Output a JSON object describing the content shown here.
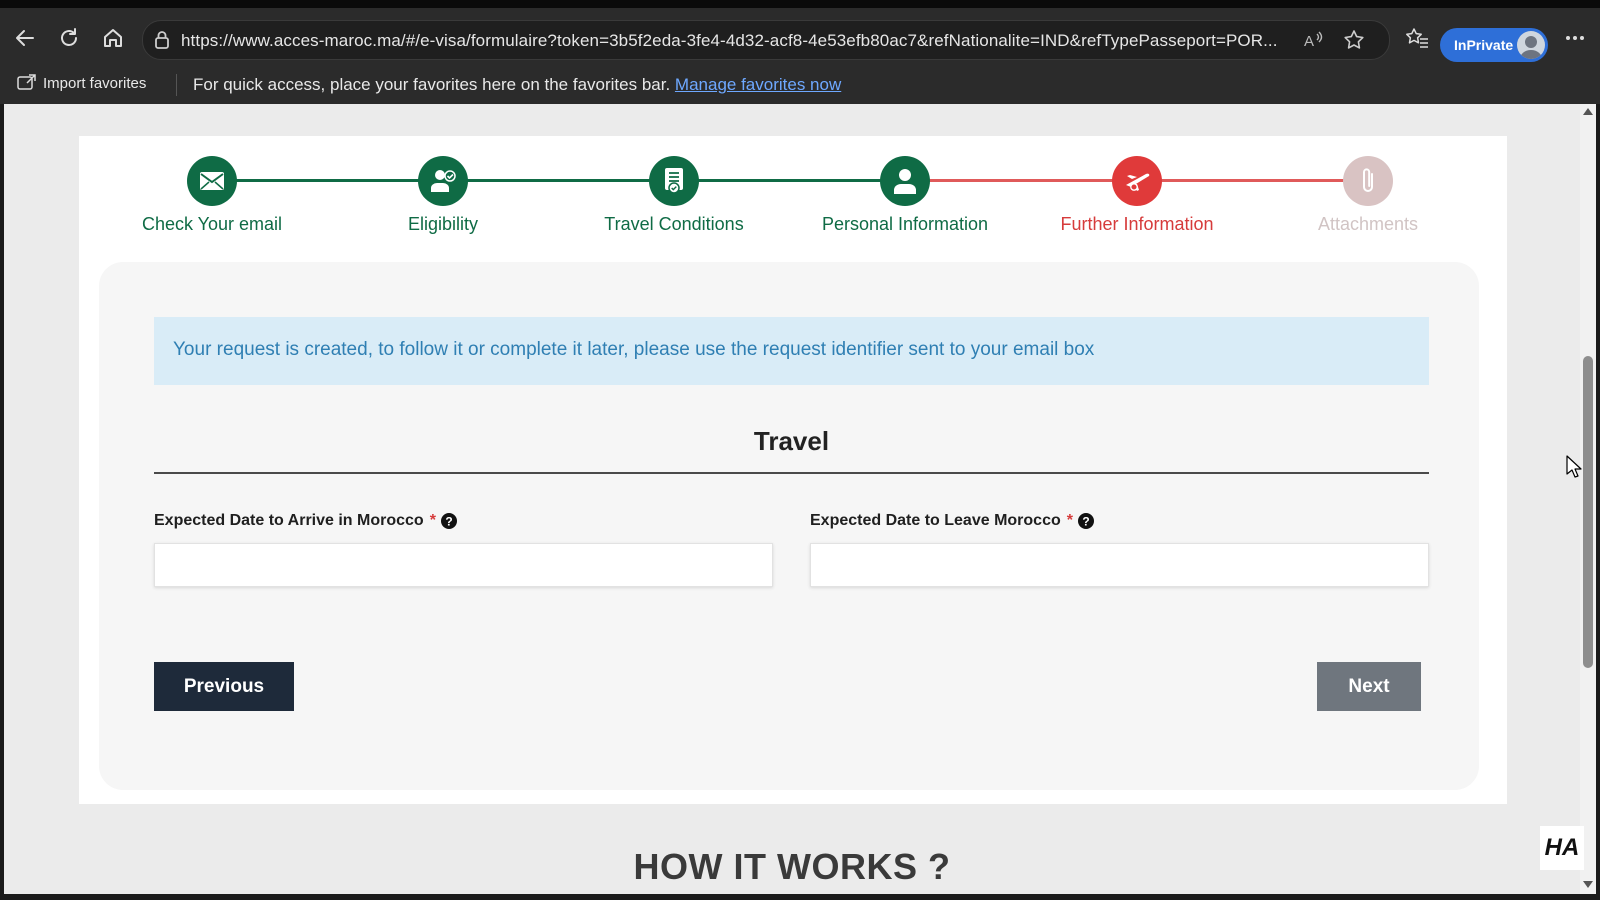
{
  "browser": {
    "url": "https://www.acces-maroc.ma/#/e-visa/formulaire?token=3b5f2eda-3fe4-4d32-acf8-4e53efb80ac7&refNationalite=IND&refTypePasseport=POR...",
    "inprivate_label": "InPrivate",
    "favorites": {
      "import_label": "Import favorites",
      "message": "For quick access, place your favorites here on the favorites bar.",
      "manage_link": "Manage favorites now"
    }
  },
  "stepper": {
    "steps": [
      {
        "label": "Check Your email",
        "icon": "envelope-icon",
        "state": "done"
      },
      {
        "label": "Eligibility",
        "icon": "person-check-icon",
        "state": "done"
      },
      {
        "label": "Travel Conditions",
        "icon": "document-badge-icon",
        "state": "done"
      },
      {
        "label": "Personal Information",
        "icon": "person-icon",
        "state": "done"
      },
      {
        "label": "Further Information",
        "icon": "plane-icon",
        "state": "active"
      },
      {
        "label": "Attachments",
        "icon": "paperclip-icon",
        "state": "pending"
      }
    ],
    "colors": {
      "done": "#0f6b45",
      "active": "#e03a3a",
      "pending": "#d9c3c3"
    }
  },
  "form": {
    "alert": "Your request is created, to follow it or complete it later, please use the request identifier sent to your email box",
    "section_title": "Travel",
    "fields": {
      "arrive": {
        "label": "Expected Date to Arrive in Morocco",
        "required_mark": "*",
        "value": ""
      },
      "leave": {
        "label": "Expected Date to Leave Morocco",
        "required_mark": "*",
        "value": ""
      }
    },
    "buttons": {
      "previous": "Previous",
      "next": "Next"
    }
  },
  "footer": {
    "heading": "HOW IT WORKS ?"
  },
  "watermark": "HA"
}
